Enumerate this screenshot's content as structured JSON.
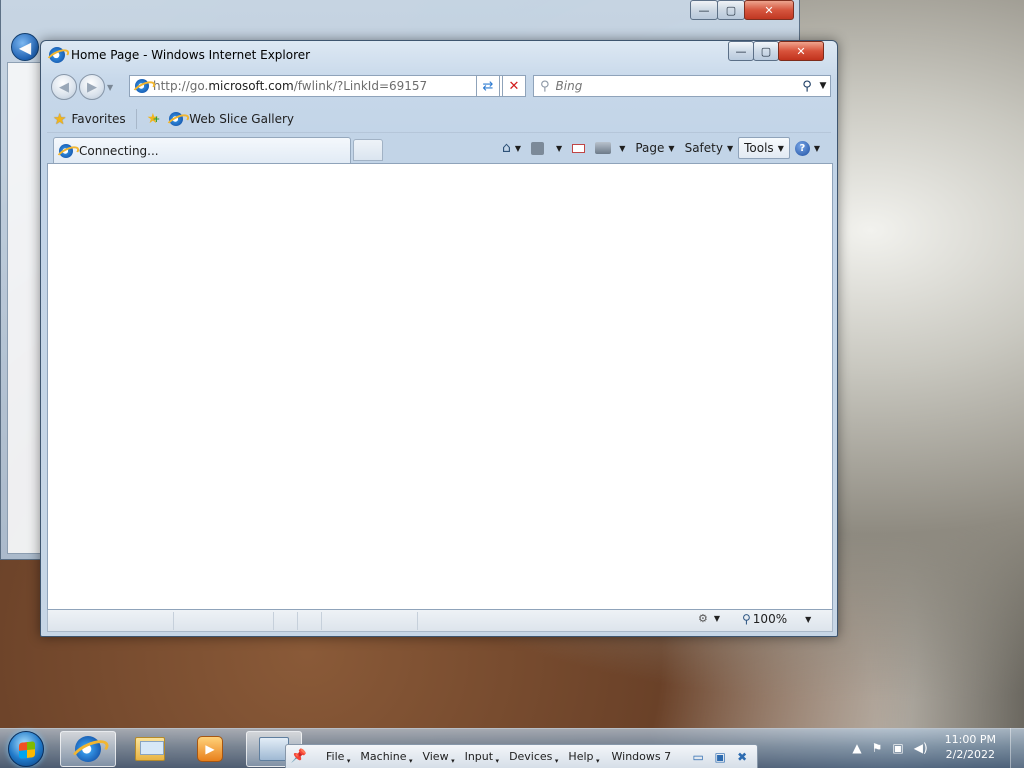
{
  "ie": {
    "window_title": "Home Page - Windows Internet Explorer",
    "address": {
      "prefix": "http://go.",
      "domain": "microsoft.com",
      "suffix": "/fwlink/?LinkId=69157"
    },
    "search_placeholder": "Bing",
    "favorites": {
      "favorites_label": "Favorites",
      "web_slice_label": "Web Slice Gallery"
    },
    "tab": {
      "label": "Connecting..."
    },
    "commands": {
      "page": "Page",
      "safety": "Safety",
      "tools": "Tools"
    },
    "status": {
      "zoom": "100%"
    }
  },
  "vm_menu": {
    "items": [
      "File",
      "Machine",
      "View",
      "Input",
      "Devices",
      "Help"
    ],
    "title": "Windows 7"
  },
  "clock": {
    "time": "11:00 PM",
    "date": "2/2/2022"
  },
  "icons": {
    "window_minimize": "—",
    "window_maximize": "▢",
    "window_close": "✕",
    "back": "◀",
    "forward": "▶",
    "refresh": "⇄",
    "stop": "✕",
    "search": "⚲",
    "home": "⌂",
    "help": "?",
    "tray_show_hidden": "▲",
    "tray_flag": "⚑",
    "tray_network": "▣",
    "tray_volume": "◀)"
  },
  "colors": {
    "close_button": "#c1331d",
    "accent": "#1a5fb4"
  }
}
